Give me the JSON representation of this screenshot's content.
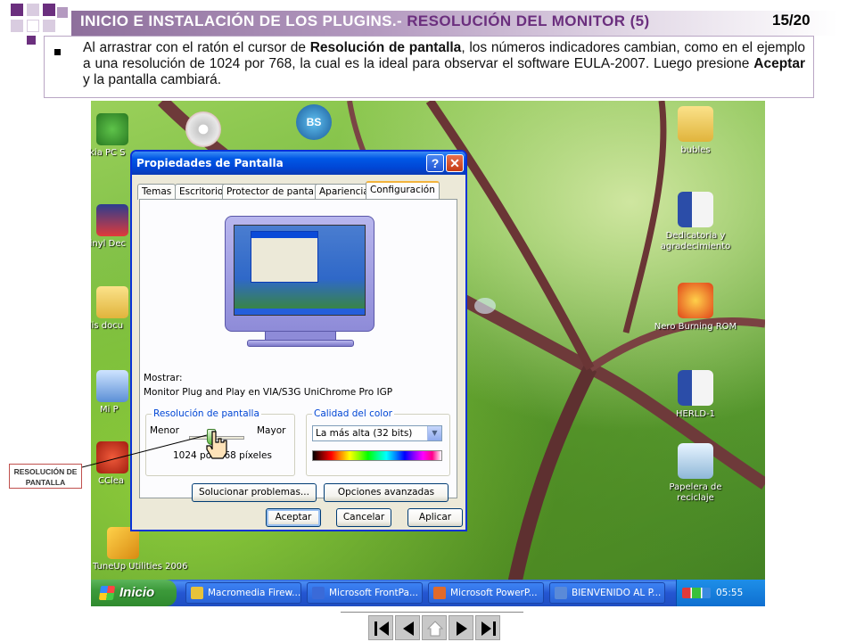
{
  "slide": {
    "title_main": "INICIO E INSTALACIÓN DE LOS PLUGINS.-",
    "title_sub": "RESOLUCIÓN DEL MONITOR (5)",
    "page_number": "15/20",
    "description_p1": "Al arrastrar con el ratón el cursor de ",
    "description_b1": "Resolución de pantalla",
    "description_p2": ", los números indicadores cambian, como en el ejemplo a una resolución de 1024 por 768, la cual es la ideal para observar el software EULA-2007. Luego presione ",
    "description_b2": "Aceptar",
    "description_p3": " y la pantalla cambiará.",
    "callout": "RESOLUCIÓN DE PANTALLA"
  },
  "desktop": {
    "left_icons": [
      {
        "label": "okia PC S",
        "icon": "nokia-pc-suite-icon"
      },
      {
        "label": "Vinyl Dec",
        "icon": "vinyl-icon"
      },
      {
        "label": "Mis docu",
        "icon": "folder-icon"
      },
      {
        "label": "Mi P",
        "icon": "computer-icon"
      },
      {
        "label": "CClea",
        "icon": "ccleaner-icon"
      },
      {
        "label": "TuneUp Utilities 2006",
        "icon": "tuneup-icon"
      }
    ],
    "right_icons": [
      {
        "label": "bubles",
        "icon": "folder-icon"
      },
      {
        "label": "Dedicatoria y agradecimiento",
        "icon": "word-document-icon"
      },
      {
        "label": "Nero Burning ROM",
        "icon": "nero-icon"
      },
      {
        "label": "HERLD-1",
        "icon": "word-document-icon"
      },
      {
        "label": "Papelera de reciclaje",
        "icon": "recycle-bin-icon"
      }
    ]
  },
  "dialog": {
    "title": "Propiedades de Pantalla",
    "help_label": "?",
    "close_label": "✕",
    "tabs": [
      "Temas",
      "Escritorio",
      "Protector de pantalla",
      "Apariencia",
      "Configuración"
    ],
    "active_tab": "Configuración",
    "display_label": "Mostrar:",
    "display_value": "Monitor Plug and Play en VIA/S3G UniChrome Pro IGP",
    "resolution_group": "Resolución de pantalla",
    "less_label": "Menor",
    "more_label": "Mayor",
    "resolution_value": "1024 por 768 píxeles",
    "color_group": "Calidad del color",
    "color_value": "La más alta (32 bits)",
    "troubleshoot_button": "Solucionar problemas...",
    "advanced_button": "Opciones avanzadas",
    "ok_button": "Aceptar",
    "cancel_button": "Cancelar",
    "apply_button": "Aplicar"
  },
  "taskbar": {
    "start_label": "Inicio",
    "items": [
      "Macromedia Firew...",
      "Microsoft FrontPa...",
      "Microsoft PowerP...",
      "BIENVENIDO AL P..."
    ],
    "clock": "05:55 p.m."
  },
  "colors": {
    "title_accent": "#6b2f7e",
    "xp_blue": "#0046d5",
    "start_green": "#3c9a3a"
  }
}
